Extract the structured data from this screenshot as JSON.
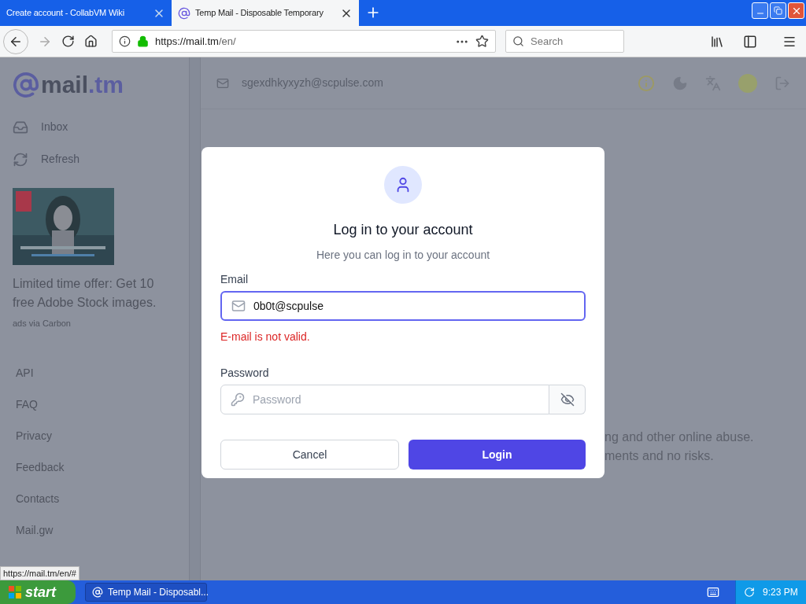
{
  "browser": {
    "tabs": [
      {
        "title": "Create account - CollabVM Wiki",
        "selected": false
      },
      {
        "title": "Temp Mail - Disposable Temporary",
        "selected": true
      }
    ],
    "url_host": "https://mail.tm",
    "url_path": "/en/",
    "search_placeholder": "Search",
    "status_url": "https://mail.tm/en/#"
  },
  "sidebar": {
    "logo_name": "mail",
    "logo_suffix": ".tm",
    "nav": [
      {
        "label": "Inbox",
        "kind": "inbox"
      },
      {
        "label": "Refresh",
        "kind": "refresh"
      }
    ],
    "ad": {
      "kind": "picture",
      "text": "Limited time offer: Get 10 free Adobe Stock images.",
      "credit": "ads via Carbon"
    },
    "links": [
      "API",
      "FAQ",
      "Privacy",
      "Feedback",
      "Contacts",
      "Mail.gw"
    ]
  },
  "header": {
    "address": "sgexdhkyxyzh@scpulse.com"
  },
  "background_lines": [
    "ng and other online abuse.",
    "ments and no risks."
  ],
  "modal": {
    "title": "Log in to your account",
    "subtitle": "Here you can log in to your account",
    "email_label": "Email",
    "email_value": "0b0t@scpulse",
    "email_error": "E-mail is not valid.",
    "password_label": "Password",
    "password_placeholder": "Password",
    "cancel": "Cancel",
    "login": "Login"
  },
  "taskbar": {
    "start": "start",
    "task": "Temp Mail - Disposabl...",
    "time": "9:23 PM"
  }
}
